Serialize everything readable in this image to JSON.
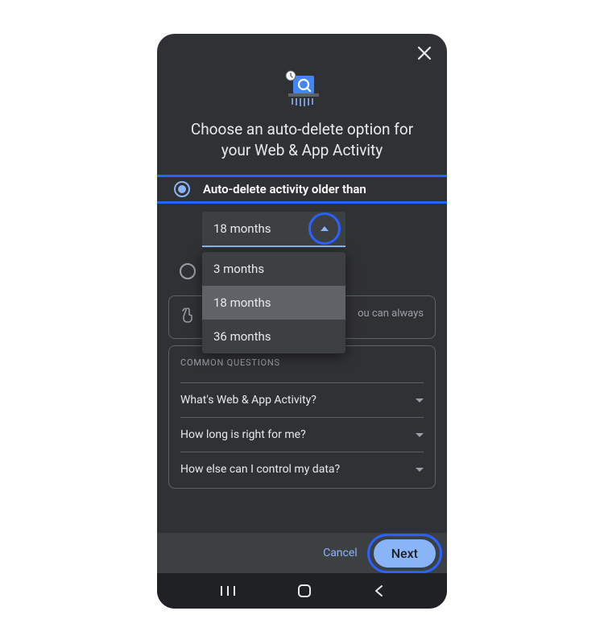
{
  "title": "Choose an auto-delete option for your Web & App Activity",
  "radio_selected_label": "Auto-delete activity older than",
  "dropdown": {
    "value": "18 months",
    "options": [
      "3 months",
      "18 months",
      "36 months"
    ],
    "selected_index": 1
  },
  "radio_unselected_label": "",
  "tip_text": "ou can always",
  "faq": {
    "header": "COMMON QUESTIONS",
    "items": [
      "What's Web & App Activity?",
      "How long is right for me?",
      "How else can I control my data?"
    ]
  },
  "actions": {
    "cancel": "Cancel",
    "next": "Next"
  },
  "highlight_color": "#2962ff",
  "accent_color": "#8ab4f8"
}
